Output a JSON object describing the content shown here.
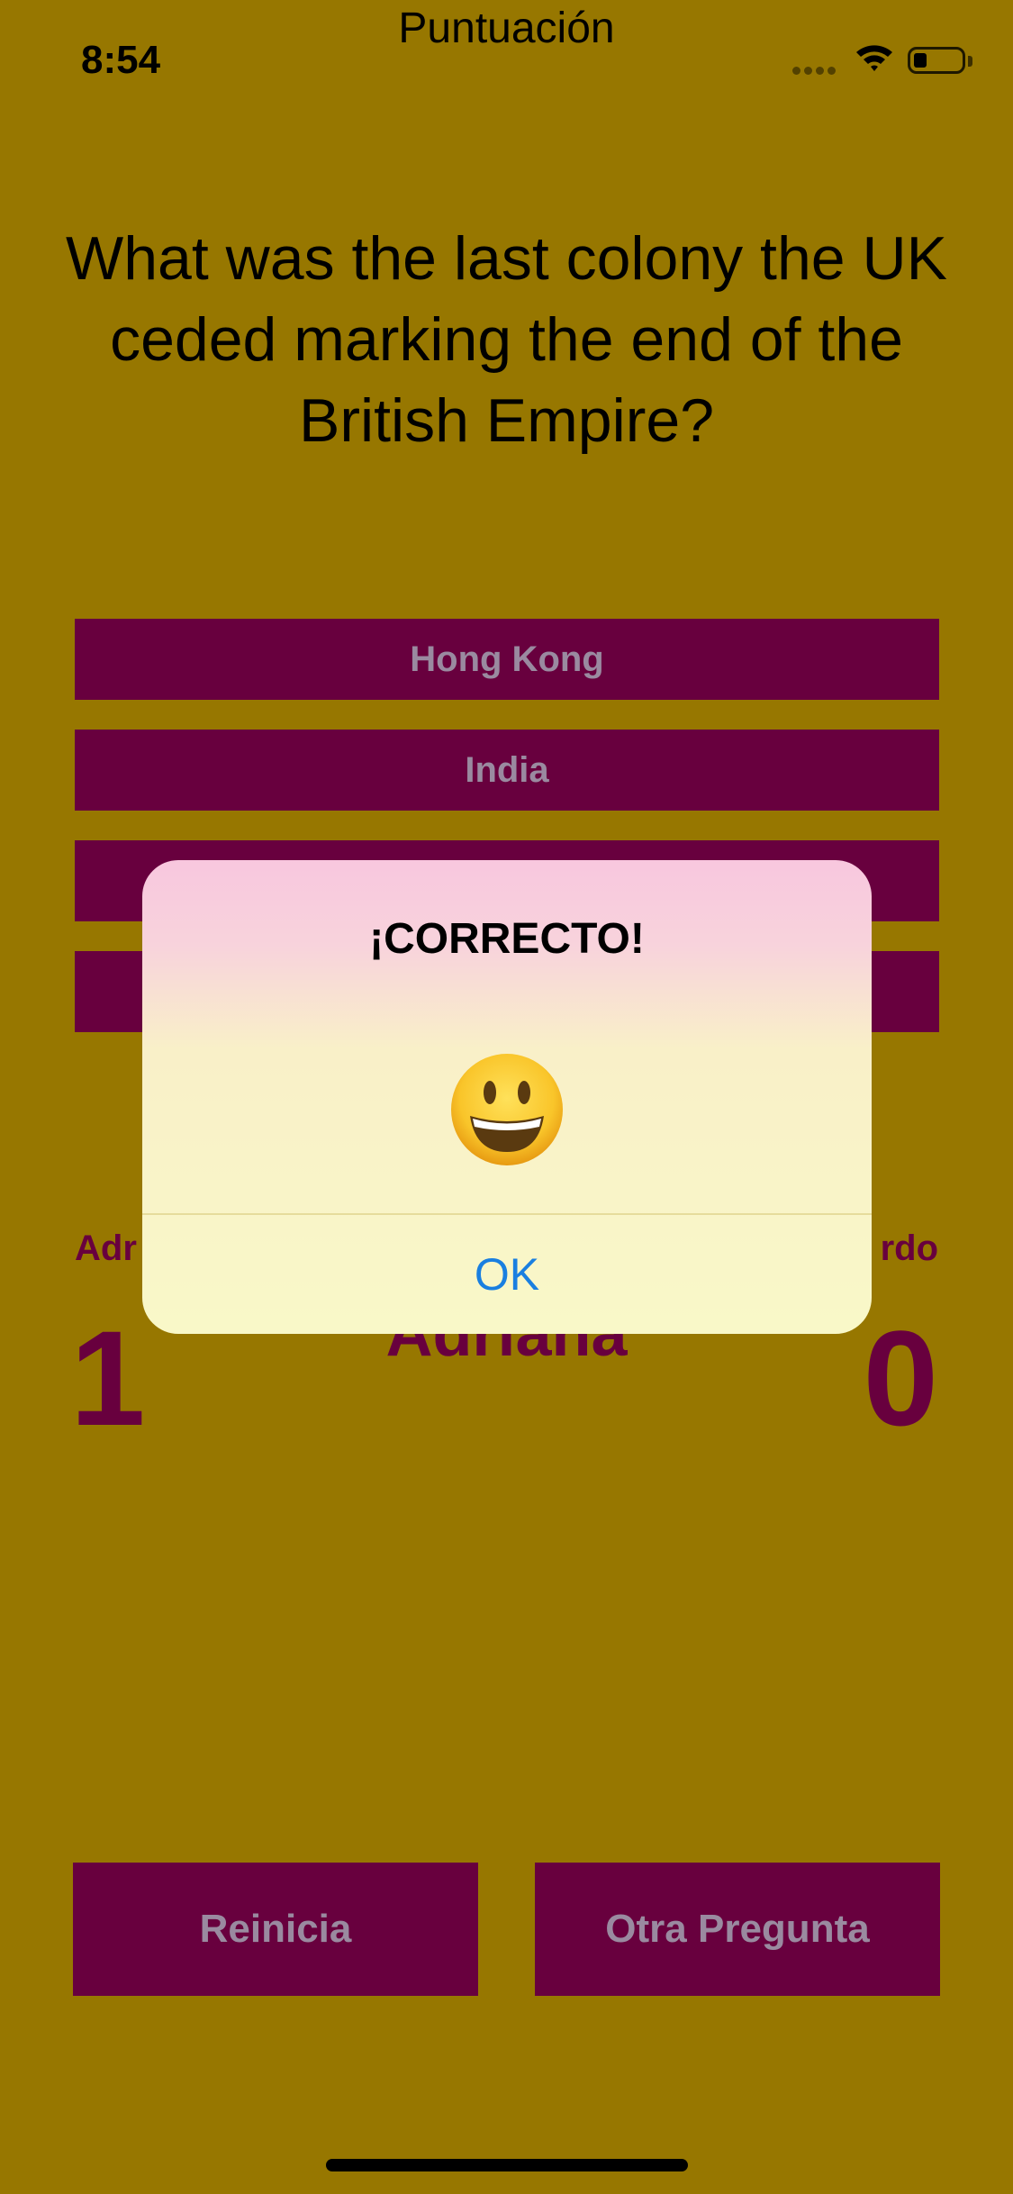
{
  "status_bar": {
    "time": "8:54"
  },
  "header": {
    "title": "Puntuación"
  },
  "question": {
    "text": "What was the last colony the UK ceded marking the end of the British Empire?"
  },
  "answers": [
    {
      "label": "Hong Kong"
    },
    {
      "label": "India"
    },
    {
      "label": ""
    },
    {
      "label": ""
    }
  ],
  "scoreboard": {
    "left_player_label": "Adr",
    "right_player_label": "rdo",
    "leader_name": "Adriana",
    "left_score": "1",
    "right_score": "0"
  },
  "buttons": {
    "reset_label": "Reinicia",
    "next_label": "Otra Pregunta"
  },
  "alert": {
    "title": "¡CORRECTO!",
    "emoji": "smiling-face-icon",
    "ok_label": "OK"
  },
  "colors": {
    "background": "#977700",
    "button": "#68003e",
    "button_text": "#9a8aa0",
    "alert_ok": "#1a7fe0"
  }
}
